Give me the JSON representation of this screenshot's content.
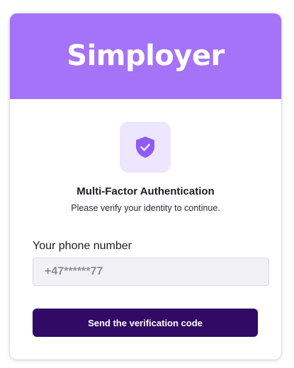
{
  "brand": {
    "name": "Simployer",
    "color": "#a473f8"
  },
  "mfa": {
    "icon": "shield-check-icon",
    "title": "Multi-Factor Authentication",
    "subtitle": "Please verify your identity to continue."
  },
  "phone": {
    "label": "Your phone number",
    "value": "+47******77"
  },
  "actions": {
    "send_label": "Send the verification code",
    "send_color": "#310a66"
  }
}
